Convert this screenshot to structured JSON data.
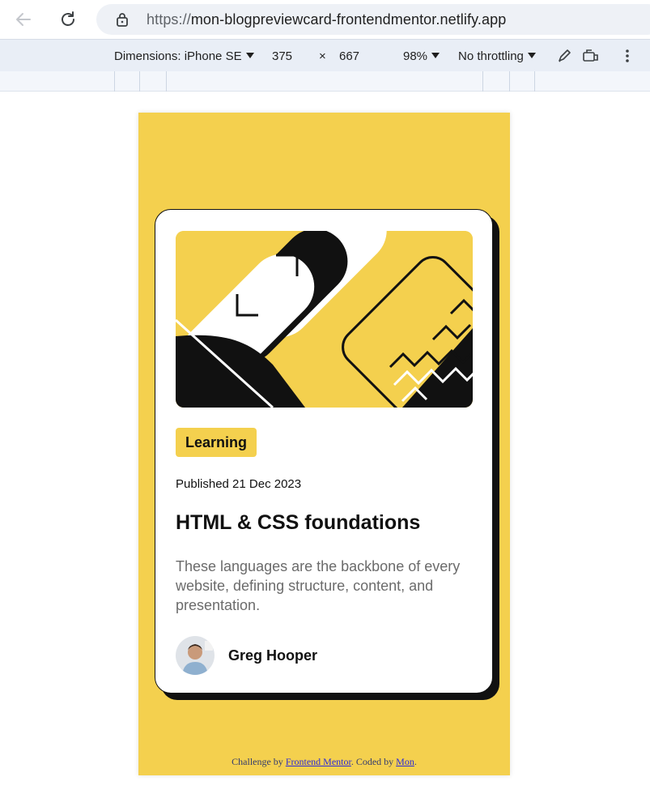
{
  "browser": {
    "url_scheme": "https://",
    "url_host": "mon-blogpreviewcard-frontendmentor.netlify.app"
  },
  "devtools": {
    "dimensions_label": "Dimensions: iPhone SE",
    "width": "375",
    "times": "×",
    "height": "667",
    "zoom": "98%",
    "throttling": "No throttling"
  },
  "card": {
    "tag": "Learning",
    "published": "Published 21 Dec 2023",
    "title": "HTML & CSS foundations",
    "description": "These languages are the backbone of every website, defining structure, content, and presentation.",
    "author_name": "Greg Hooper"
  },
  "footer": {
    "prefix": "Challenge by ",
    "fm_link": "Frontend Mentor",
    "middle": ". Coded by ",
    "author_link": "Mon",
    "suffix": "."
  },
  "colors": {
    "yellow": "#f4d04e",
    "ink": "#111111",
    "muted": "#6b6b6b"
  }
}
